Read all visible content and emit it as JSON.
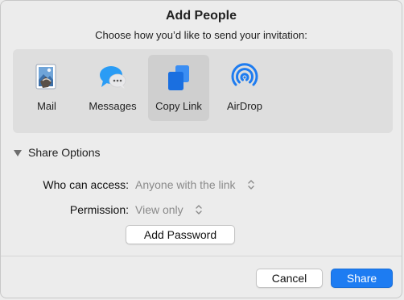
{
  "dialog": {
    "title": "Add People",
    "subtitle": "Choose how you’d like to send your invitation:"
  },
  "methods": [
    {
      "label": "Mail",
      "icon": "mail-stamp-icon",
      "selected": false
    },
    {
      "label": "Messages",
      "icon": "messages-bubble-icon",
      "selected": false
    },
    {
      "label": "Copy Link",
      "icon": "copy-link-icon",
      "selected": true
    },
    {
      "label": "AirDrop",
      "icon": "airdrop-icon",
      "selected": false
    }
  ],
  "share_options": {
    "label": "Share Options",
    "expanded": true,
    "access_label": "Who can access:",
    "access_value": "Anyone with the link",
    "permission_label": "Permission:",
    "permission_value": "View only",
    "add_password_label": "Add Password"
  },
  "footer": {
    "cancel_label": "Cancel",
    "share_label": "Share"
  },
  "colors": {
    "accent": "#1d7cf2",
    "messages_blue": "#2a9cf5",
    "airdrop_blue": "#1e7cf0",
    "copy_link_blue": "#1a6fe0"
  }
}
